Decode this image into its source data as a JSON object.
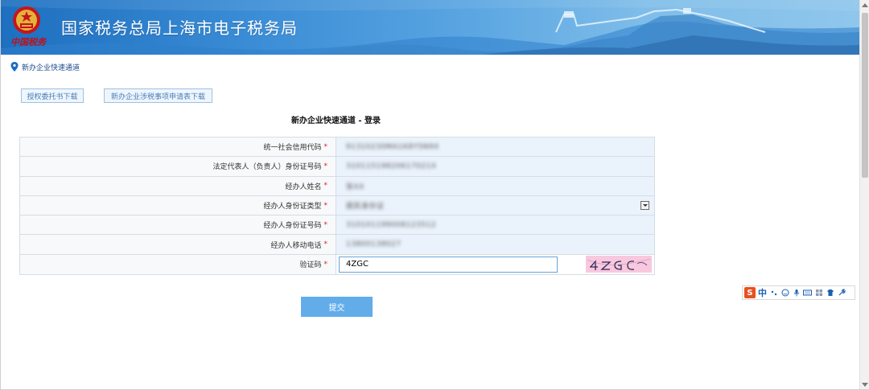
{
  "header": {
    "site_title": "国家税务总局上海市电子税务局",
    "brand_script": "中国税务"
  },
  "breadcrumb": {
    "text": "新办企业快速通道"
  },
  "downloads": {
    "auth_button": "授权委托书下载",
    "tax_form_button": "新办企业涉税事项申请表下载"
  },
  "form": {
    "title": "新办企业快速通道 - 登录",
    "fields": [
      {
        "label": "统一社会信用代码",
        "required": "*",
        "value": "91310230MA1K8Y5N9X"
      },
      {
        "label": "法定代表人（负责人）身份证号码",
        "required": "*",
        "value": "31011519820617021X"
      },
      {
        "label": "经办人姓名",
        "required": "*",
        "value": "张XX"
      },
      {
        "label": "经办人身份证类型",
        "required": "*",
        "value": "居民身份证"
      },
      {
        "label": "经办人身份证号码",
        "required": "*",
        "value": "310101199008123512"
      },
      {
        "label": "经办人移动电话",
        "required": "*",
        "value": "13800138027"
      }
    ],
    "captcha": {
      "label": "验证码",
      "required": "*",
      "input_value": "4ZGC",
      "image_text": "4ZGC"
    },
    "submit_label": "提交"
  },
  "ime_toolbar": {
    "logo": "S",
    "lang": "中",
    "icons": [
      "punctuation-icon",
      "emoji-icon",
      "voice-icon",
      "keyboard-icon",
      "tools-icon",
      "skin-icon",
      "settings-icon"
    ]
  },
  "colors": {
    "banner_start": "#1d6fc0",
    "banner_end": "#8fc6ec",
    "required_mark": "#e02020",
    "submit": "#62acea",
    "value_bg": "#eaf2fb"
  }
}
